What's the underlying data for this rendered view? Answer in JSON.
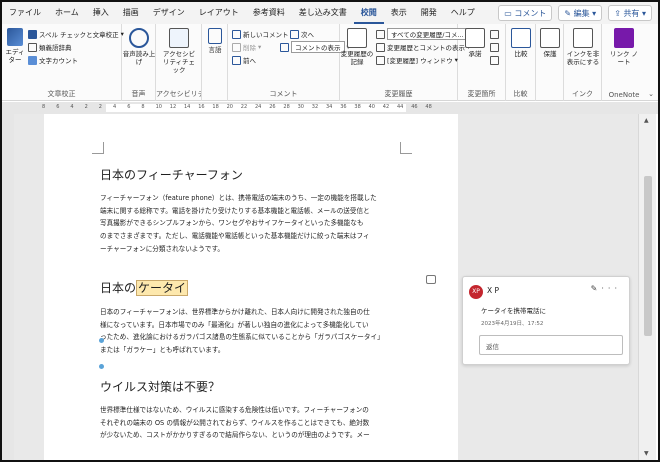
{
  "ribbon_tabs": [
    "ファイル",
    "ホーム",
    "挿入",
    "描画",
    "デザイン",
    "レイアウト",
    "参考資料",
    "差し込み文書",
    "校閲",
    "表示",
    "開発",
    "ヘルプ"
  ],
  "active_tab": "校閲",
  "top_actions": {
    "comment": "コメント",
    "edit": "編集",
    "share": "共有"
  },
  "groups": {
    "proofing": {
      "label": "文章校正",
      "editor": "エディ\nター",
      "spelling": "スペル チェックと文章校正",
      "thesaurus": "類義語辞典",
      "wordcount": "文字カウント"
    },
    "speech": {
      "label": "音声",
      "readaloud": "音声読み上げ"
    },
    "accessibility": {
      "label": "アクセシビリティ",
      "check": "アクセシビリティチェック"
    },
    "language": {
      "label": "",
      "lang": "言語"
    },
    "comments": {
      "label": "コメント",
      "new": "新しいコメント",
      "next": "次へ",
      "delete": "削除",
      "prev": "前へ",
      "show": "コメントの表示"
    },
    "tracking": {
      "label": "変更履歴",
      "record": "変更履歴の記録",
      "all_markup": "すべての変更履歴/コメ...",
      "show_markup": "変更履歴とコメントの表示",
      "pane": "[変更履歴] ウィンドウ"
    },
    "changes": {
      "label": "変更箇所",
      "accept": "承諾"
    },
    "compare": {
      "label": "比較",
      "compare": "比較"
    },
    "protect": {
      "label": "",
      "protect": "保護"
    },
    "ink": {
      "label": "インク",
      "hide_ink": "インクを非表示にする"
    },
    "onenote": {
      "label": "OneNote",
      "linked": "リンク ノート"
    }
  },
  "ruler_numbers": [
    "8",
    "6",
    "4",
    "2",
    "2",
    "4",
    "6",
    "8",
    "10",
    "12",
    "14",
    "16",
    "18",
    "20",
    "22",
    "24",
    "26",
    "28",
    "30",
    "32",
    "34",
    "36",
    "38",
    "40",
    "42",
    "44",
    "46",
    "48"
  ],
  "document": {
    "h1": "日本のフィーチャーフォン",
    "p1": [
      "フィーチャーフォン（feature phone）とは、携帯電話の端末のうち、一定の機能を搭載した",
      "端末に関する総称です。電話を掛けたり受けたりする基本機能と電話帳、メールの送受信と",
      "写真撮影ができるシンプルフォンから、ワンセグやおサイフケータイといった多機能なも",
      "のまでさまざまです。ただし、電話機能や電話帳といった基本機能だけに絞った端末はフィ",
      "ーチャーフォンに分類されないようです。"
    ],
    "h2_prefix": "日本の",
    "h2_highlight": "ケータイ",
    "p2": [
      "日本のフィーチャーフォンは、世界標準からかけ離れた、日本人向けに開発された独自の仕",
      "様になっています。日本市場でのみ「最適化」が著しい独自の進化によって多機能化してい",
      "ったため、進化論におけるガラパゴス諸島の生態系に似ていることから「ガラパゴスケータイ」",
      "または「ガラケー」とも呼ばれています。"
    ],
    "h3": "ウイルス対策は不要？",
    "p3": [
      "世界標準仕様ではないため、ウイルスに感染する危険性は低いです。フィーチャーフォンの",
      "それぞれの端末の OS の情報が公開されておらず、ウイルスを作ることはできても、絶対数",
      "が少ないため、コストがかかりすぎるので結局作らない、というのが理由のようです。メー"
    ]
  },
  "comment": {
    "initials": "XP",
    "author": "X P",
    "text": "ケータイを携帯電話に",
    "date": "2023年4月19日、17:52",
    "reply_placeholder": "返信",
    "edit_icon": "pencil-icon",
    "more_icon": "ellipsis-icon"
  },
  "colors": {
    "accent": "#2b579a",
    "highlight": "#fde8ad",
    "avatar": "#c4262e"
  }
}
